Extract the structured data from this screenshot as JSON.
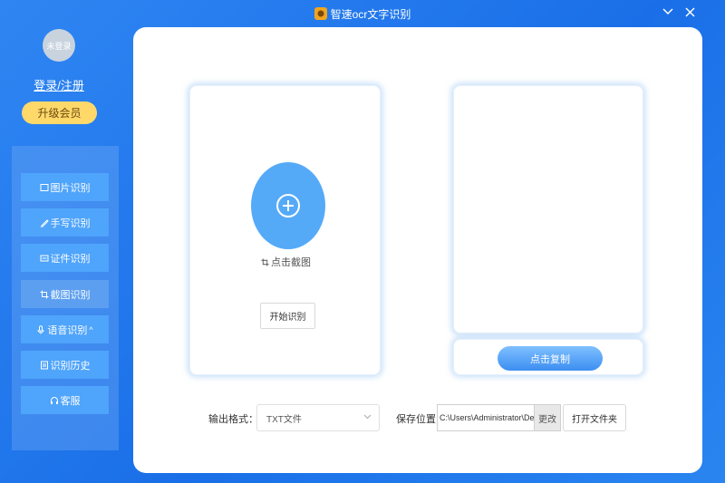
{
  "window": {
    "title": "智速ocr文字识别",
    "logo_icon": "app-logo-icon",
    "minimize_icon": "chevron-down-icon",
    "close_icon": "close-icon"
  },
  "account": {
    "avatar_text": "未登录",
    "login_label": "登录/注册",
    "vip_label": "升级会员"
  },
  "sidebar": {
    "items": [
      {
        "label": "图片识别",
        "icon": "image-icon"
      },
      {
        "label": "手写识别",
        "icon": "pen-icon"
      },
      {
        "label": "证件识别",
        "icon": "id-card-icon"
      },
      {
        "label": "截图识别",
        "icon": "crop-icon"
      },
      {
        "label": "语音识别",
        "badge": "^",
        "icon": "microphone-icon"
      },
      {
        "label": "识别历史",
        "icon": "history-icon"
      },
      {
        "label": "客服",
        "icon": "headset-icon"
      }
    ],
    "active_index": 3
  },
  "main": {
    "screenshot_label": "点击截图",
    "start_button": "开始识别",
    "copy_button": "点击复制",
    "format_label": "输出格式：",
    "format_value": "TXT文件",
    "save_label": "保存位置:",
    "save_path": "C:\\Users\\Administrator\\Desk",
    "change_button": "更改",
    "open_folder_button": "打开文件夹"
  },
  "colors": {
    "background": "#1a6fe8",
    "sidebar_item": "#4fa4fb",
    "upload_circle": "#55aaf8",
    "vip_button": "#ffd86a",
    "copy_button": "#3c8ef2"
  }
}
